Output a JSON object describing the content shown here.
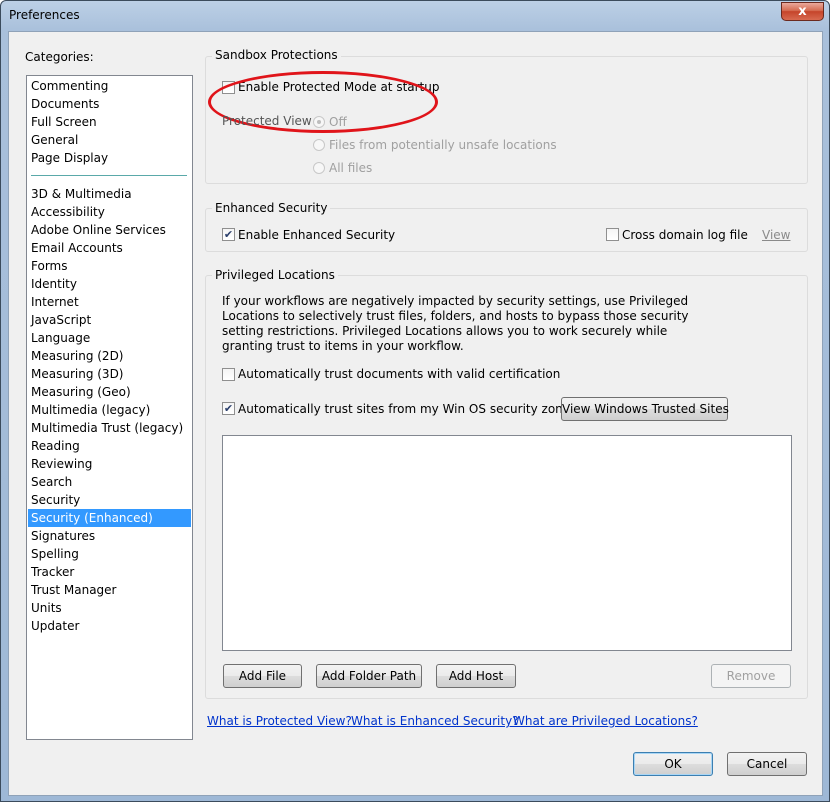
{
  "window": {
    "title": "Preferences",
    "close_glyph": "x"
  },
  "categories": {
    "label": "Categories:",
    "group1": [
      "Commenting",
      "Documents",
      "Full Screen",
      "General",
      "Page Display"
    ],
    "group2": [
      "3D & Multimedia",
      "Accessibility",
      "Adobe Online Services",
      "Email Accounts",
      "Forms",
      "Identity",
      "Internet",
      "JavaScript",
      "Language",
      "Measuring (2D)",
      "Measuring (3D)",
      "Measuring (Geo)",
      "Multimedia (legacy)",
      "Multimedia Trust (legacy)",
      "Reading",
      "Reviewing",
      "Search",
      "Security",
      "Security (Enhanced)",
      "Signatures",
      "Spelling",
      "Tracker",
      "Trust Manager",
      "Units",
      "Updater"
    ],
    "selected": "Security (Enhanced)"
  },
  "sandbox": {
    "title": "Sandbox Protections",
    "protected_mode_label": "Enable Protected Mode at startup",
    "protected_mode_checked": false,
    "protected_view_label": "Protected View",
    "options": [
      "Off",
      "Files from potentially unsafe locations",
      "All files"
    ],
    "selected_option": "Off"
  },
  "enhanced": {
    "title": "Enhanced Security",
    "enable_label": "Enable Enhanced Security",
    "enable_checked": true,
    "cross_domain_label": "Cross domain log file",
    "cross_domain_checked": false,
    "view_link": "View"
  },
  "privileged": {
    "title": "Privileged Locations",
    "description": "If your workflows are negatively impacted by security settings, use Privileged Locations to selectively trust files, folders, and hosts to bypass those security setting restrictions. Privileged Locations allows you to work securely while granting trust to items in your workflow.",
    "auto_trust_cert_label": "Automatically trust documents with valid certification",
    "auto_trust_cert_checked": false,
    "auto_trust_sites_label": "Automatically trust sites from my Win OS security zones",
    "auto_trust_sites_checked": true,
    "view_trusted_sites_button": "View Windows Trusted Sites",
    "add_file_button": "Add File",
    "add_folder_button": "Add Folder Path",
    "add_host_button": "Add Host",
    "remove_button": "Remove"
  },
  "links": {
    "protected_view": "What is Protected View?",
    "enhanced_security": "What is Enhanced Security?",
    "privileged_locations": "What are Privileged Locations?"
  },
  "footer": {
    "ok_button": "OK",
    "cancel_button": "Cancel"
  },
  "colors": {
    "selection": "#3399ff",
    "link": "#0033cc",
    "annotation": "#e0141a"
  }
}
